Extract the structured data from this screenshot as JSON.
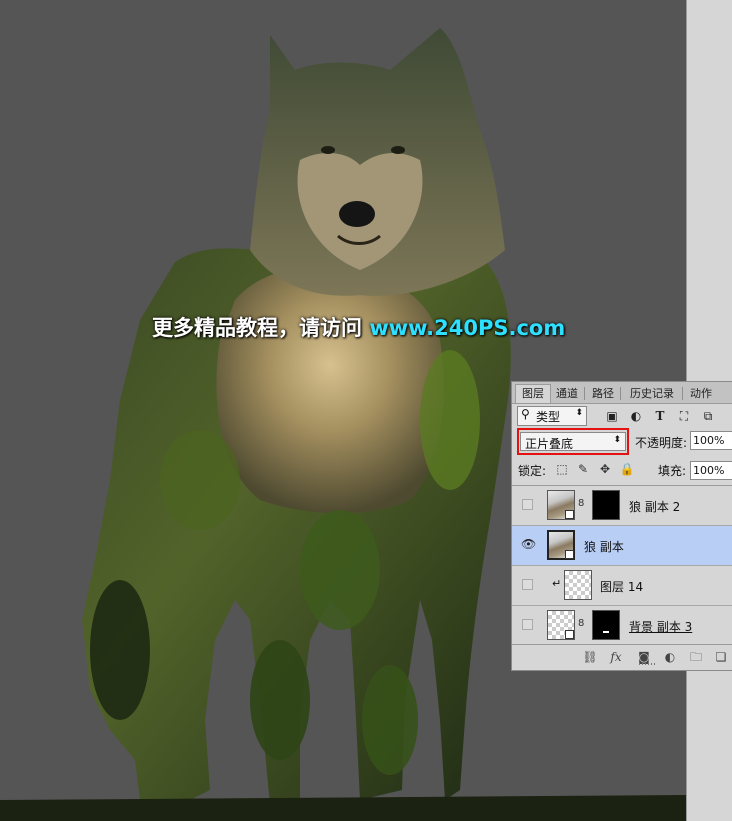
{
  "watermark": {
    "text_cn": "更多精品教程，请访问 ",
    "url": "www.240PS.com"
  },
  "layers_panel": {
    "tabs": [
      "图层",
      "通道",
      "路径",
      "历史记录",
      "动作"
    ],
    "active_tab": "图层",
    "filter": {
      "icon": "search-icon",
      "label": "类型"
    },
    "filter_icons": [
      "image-filter-icon",
      "adjustment-filter-icon",
      "type-filter-icon",
      "shape-filter-icon",
      "smart-object-filter-icon"
    ],
    "blend_mode": "正片叠底",
    "opacity_label": "不透明度:",
    "opacity_value": "100%",
    "lock_label": "锁定:",
    "lock_icons": [
      "lock-transparent-icon",
      "lock-paint-icon",
      "lock-position-icon",
      "lock-all-icon"
    ],
    "fill_label": "填充:",
    "fill_value": "100%",
    "layers": [
      {
        "name": "狼 副本 2",
        "visible": false,
        "selected": false,
        "has_mask": true
      },
      {
        "name": "狼 副本",
        "visible": true,
        "selected": true,
        "has_mask": false
      },
      {
        "name": "图层 14",
        "visible": false,
        "selected": false,
        "clipped": true
      },
      {
        "name": "背景 副本 3",
        "visible": false,
        "selected": false,
        "has_mask": true
      }
    ],
    "footer_icons": [
      "link-layers-icon",
      "fx-icon",
      "add-mask-icon",
      "adjustment-layer-icon",
      "new-group-icon",
      "new-layer-icon"
    ]
  },
  "colors": {
    "canvas_bg": "#555555",
    "panel_bg": "#d6d6d6",
    "selected_row": "#b9cef5",
    "highlight_box": "#e51212",
    "watermark_url": "#2ee0ff"
  }
}
